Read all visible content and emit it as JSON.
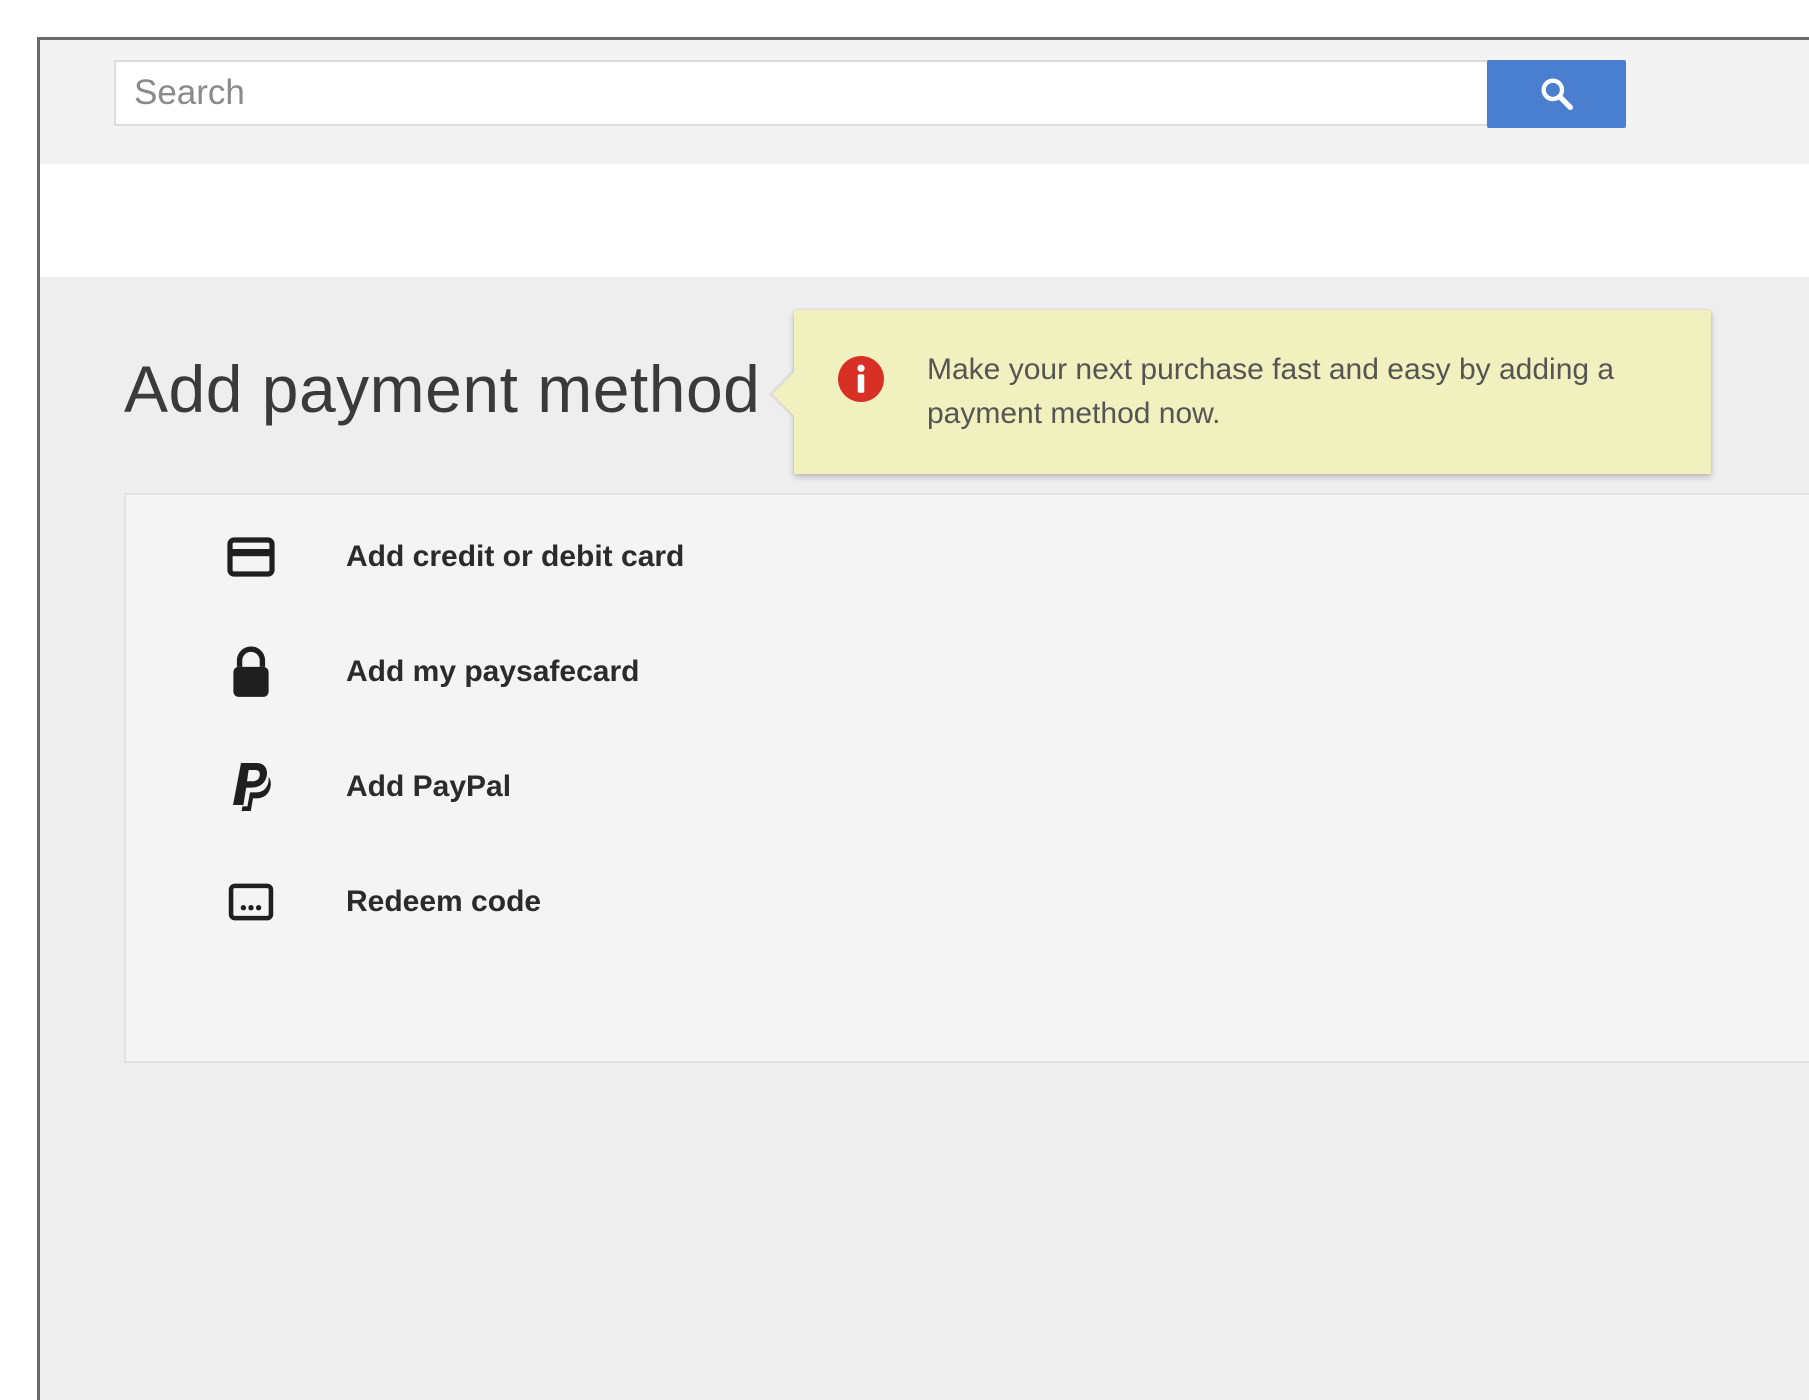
{
  "search": {
    "placeholder": "Search",
    "button_icon": "search-icon"
  },
  "page": {
    "title": "Add payment method"
  },
  "tooltip": {
    "icon": "alert-icon",
    "message": "Make your next purchase fast and easy by adding a payment method now.",
    "background": "#f1f0bf",
    "icon_color": "#d93025"
  },
  "options": [
    {
      "icon": "credit-card-icon",
      "label": "Add credit or debit card"
    },
    {
      "icon": "lock-icon",
      "label": "Add my paysafecard"
    },
    {
      "icon": "paypal-icon",
      "label": "Add PayPal"
    },
    {
      "icon": "redeem-code-icon",
      "label": "Redeem code"
    }
  ],
  "colors": {
    "accent": "#4a7fcf",
    "page_background": "#eeeeee"
  }
}
